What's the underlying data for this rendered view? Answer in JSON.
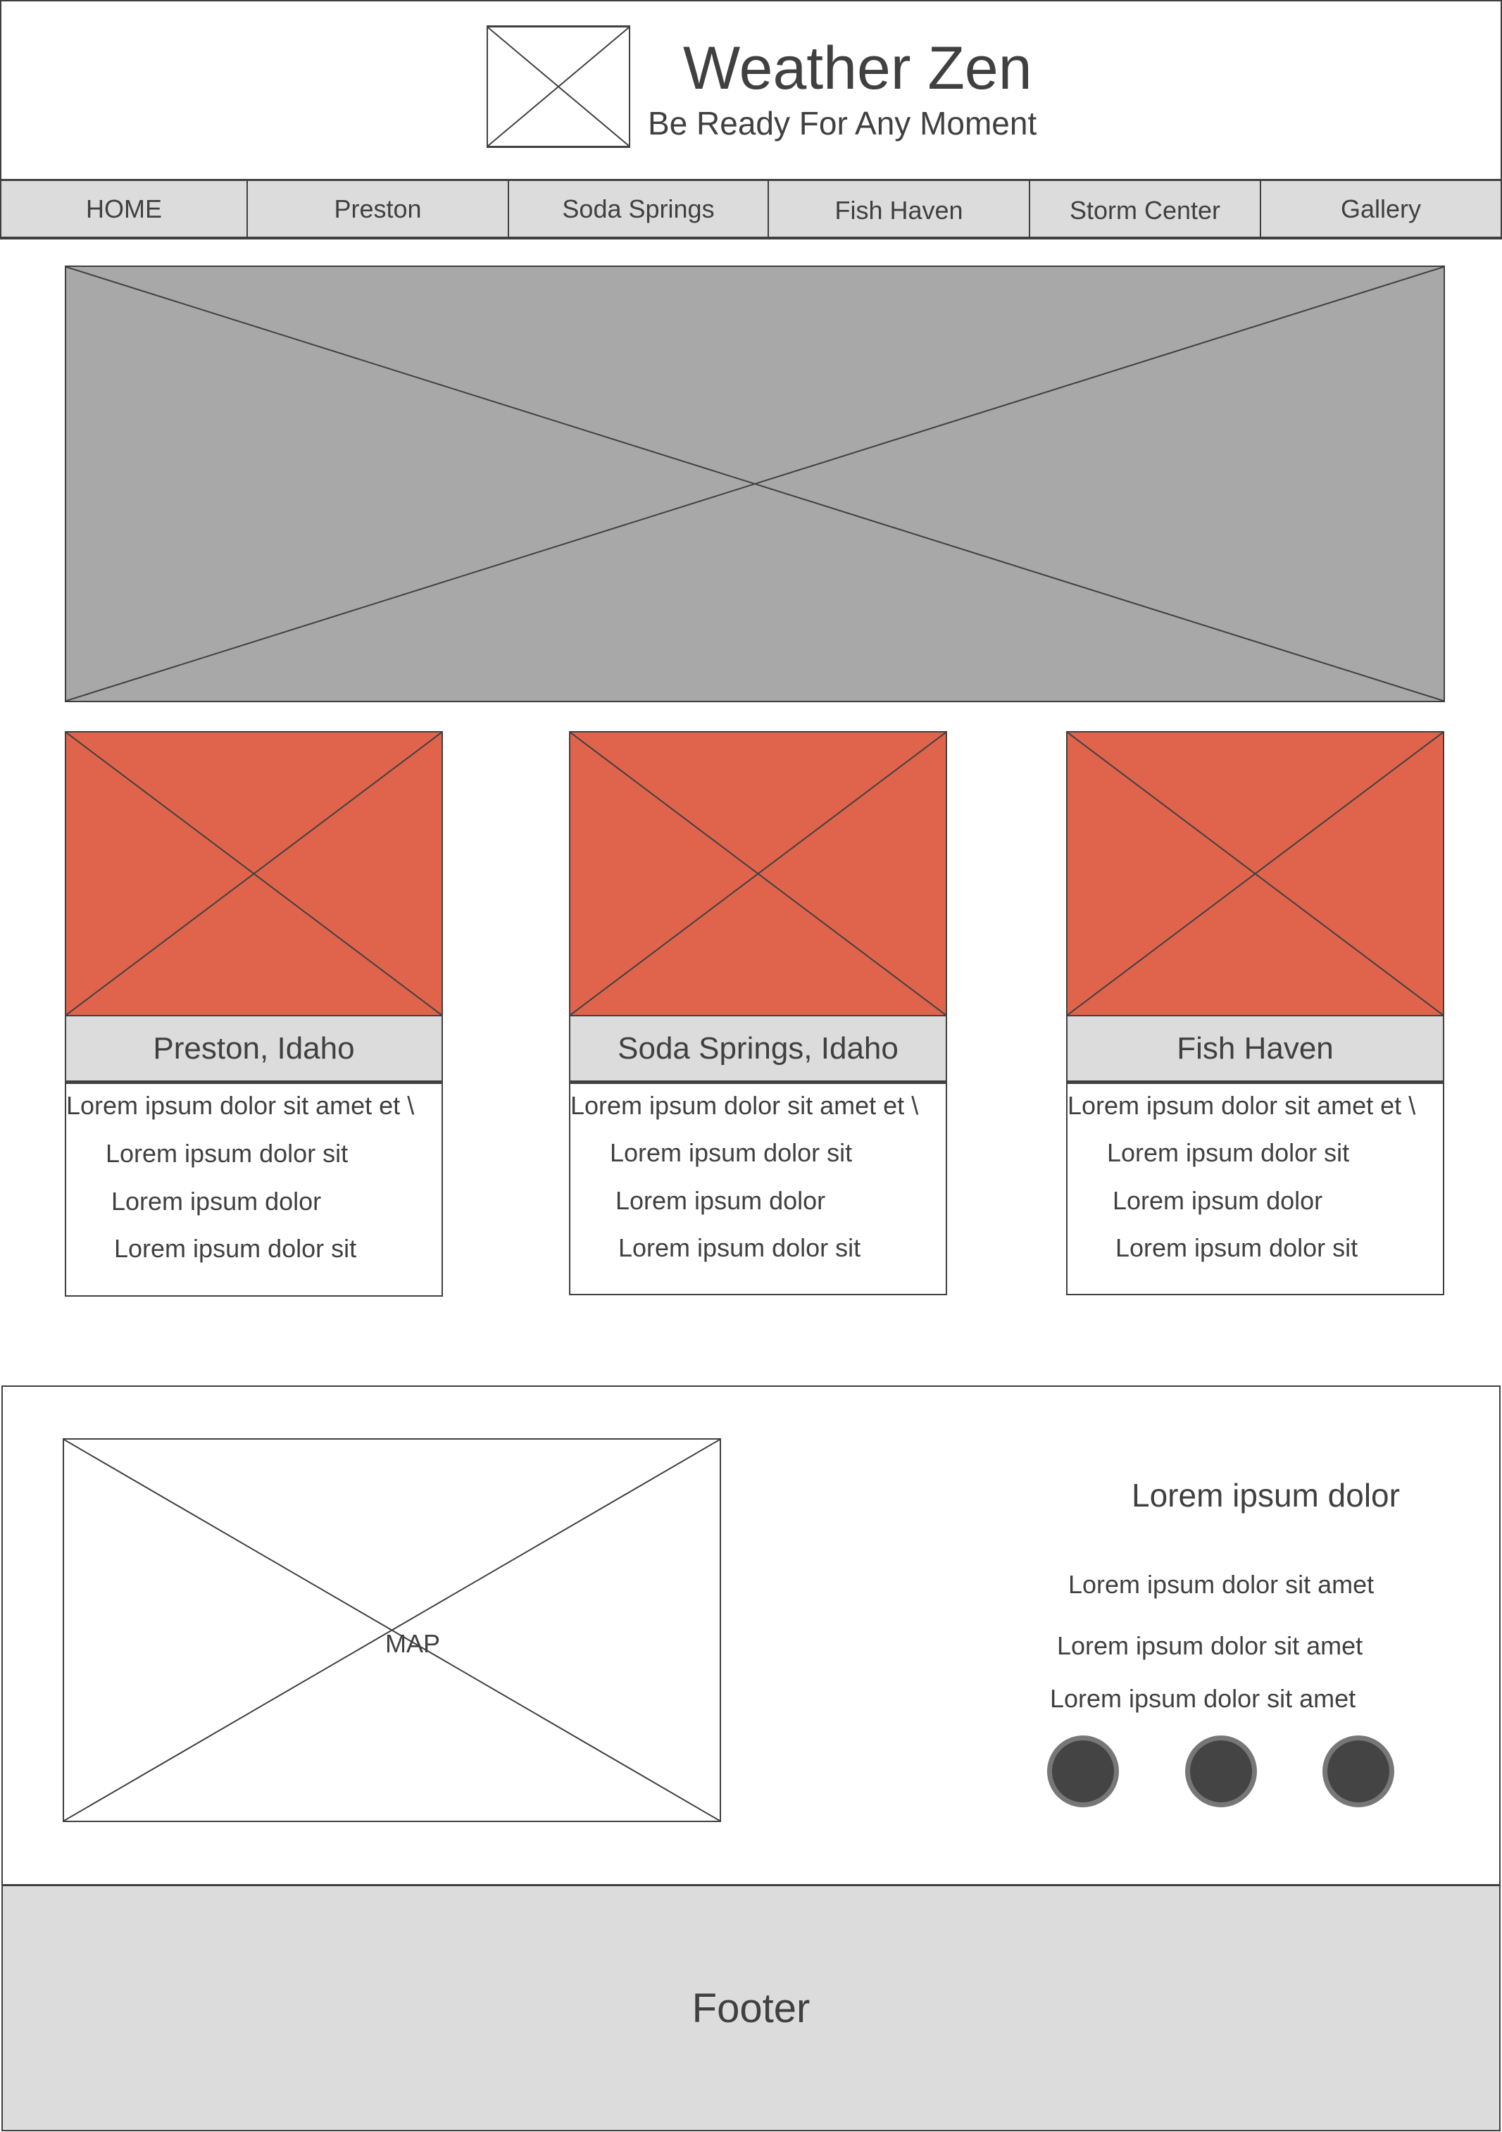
{
  "header": {
    "title": "Weather Zen",
    "tagline": "Be Ready For Any Moment",
    "logo_icon": "image-placeholder-icon"
  },
  "nav": {
    "items": [
      {
        "label": "HOME"
      },
      {
        "label": "Preston"
      },
      {
        "label": "Soda Springs"
      },
      {
        "label": "Fish Haven"
      },
      {
        "label": "Storm Center"
      },
      {
        "label": "Gallery"
      }
    ]
  },
  "hero": {
    "icon": "image-placeholder-icon"
  },
  "cards": [
    {
      "title": "Preston, Idaho",
      "lines": [
        "Lorem ipsum dolor sit amet et \\",
        "Lorem ipsum dolor sit",
        "Lorem ipsum dolor",
        "Lorem ipsum dolor sit"
      ]
    },
    {
      "title": "Soda Springs, Idaho",
      "lines": [
        "Lorem ipsum dolor sit amet et \\",
        "Lorem ipsum dolor sit",
        "Lorem ipsum dolor",
        "Lorem ipsum dolor sit"
      ]
    },
    {
      "title": "Fish Haven",
      "lines": [
        "Lorem ipsum dolor sit amet et \\",
        "Lorem ipsum dolor sit",
        "Lorem ipsum dolor",
        "Lorem ipsum dolor sit"
      ]
    }
  ],
  "info": {
    "map_label": "MAP",
    "heading": "Lorem ipsum dolor",
    "lines": [
      "Lorem ipsum dolor sit amet",
      "Lorem ipsum dolor sit amet",
      "Lorem ipsum dolor sit amet"
    ],
    "social_icons": [
      "social-icon-1",
      "social-icon-2",
      "social-icon-3"
    ]
  },
  "footer": {
    "label": "Footer"
  },
  "colors": {
    "card_image": "#e0644c",
    "hero_image": "#a8a8a8",
    "nav_background": "#dcdcdc",
    "footer_background": "#dcdcdc",
    "stroke": "#404040"
  }
}
